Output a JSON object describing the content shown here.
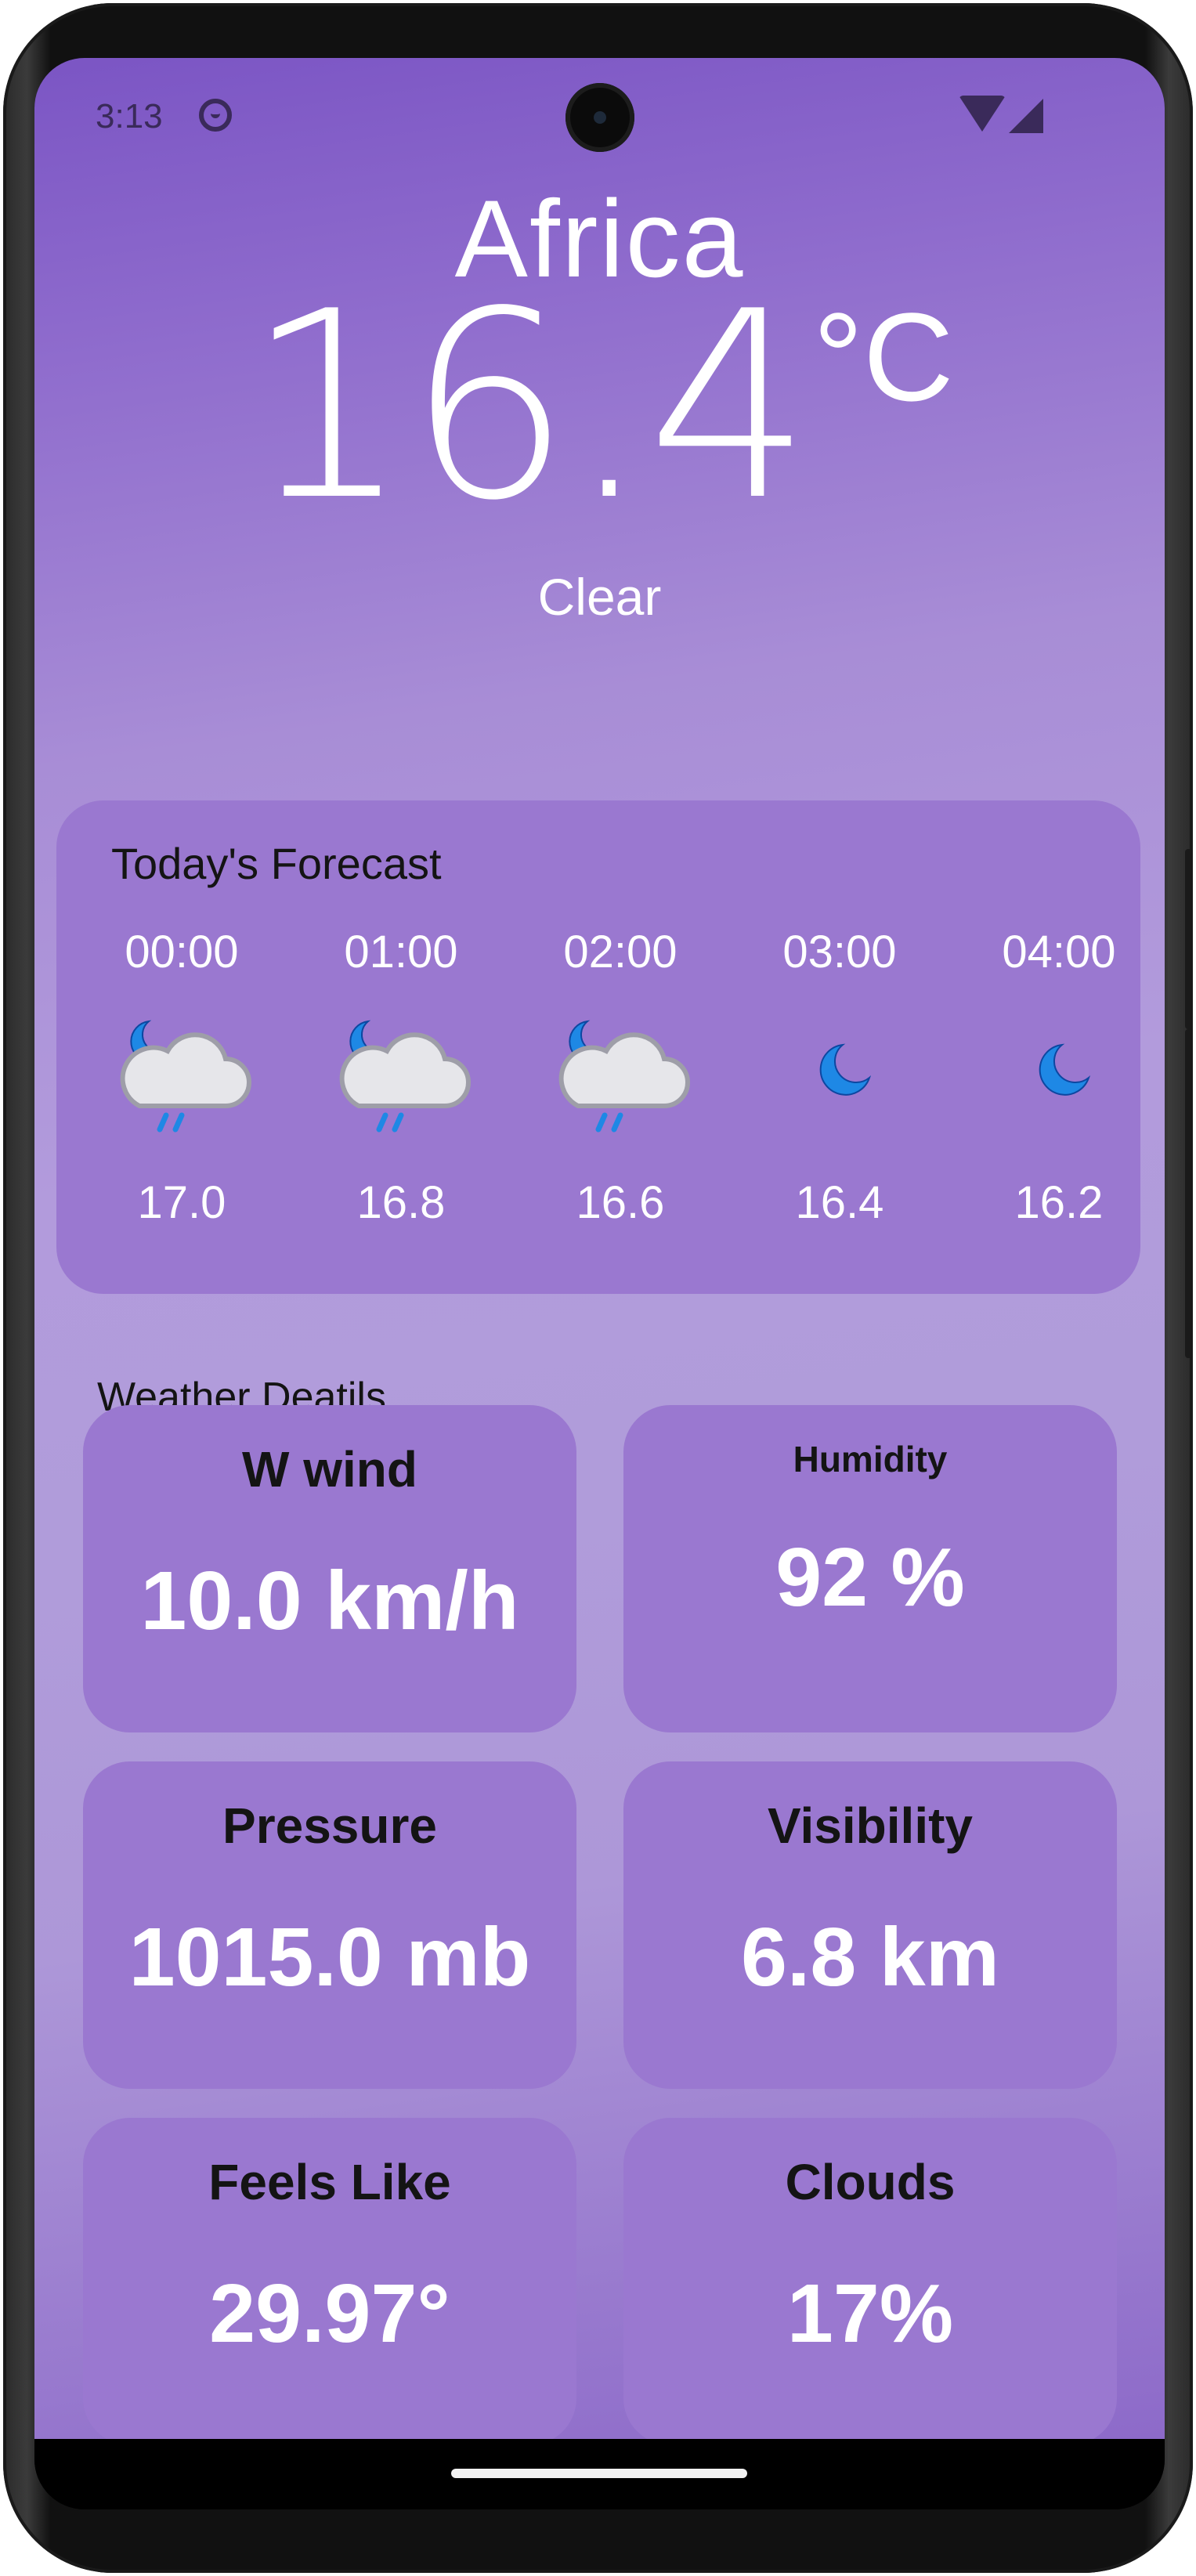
{
  "status_bar": {
    "time": "3:13"
  },
  "header": {
    "city": "Africa",
    "temperature": "16.4",
    "unit": "°C",
    "condition": "Clear"
  },
  "forecast": {
    "title": "Today's Forecast",
    "hours": [
      {
        "time": "00:00",
        "temp": "17.0",
        "icon": "moon-cloud-rain-icon"
      },
      {
        "time": "01:00",
        "temp": "16.8",
        "icon": "moon-cloud-rain-icon"
      },
      {
        "time": "02:00",
        "temp": "16.6",
        "icon": "moon-cloud-rain-icon"
      },
      {
        "time": "03:00",
        "temp": "16.4",
        "icon": "moon-icon"
      },
      {
        "time": "04:00",
        "temp": "16.2",
        "icon": "moon-icon"
      }
    ]
  },
  "details": {
    "title": "Weather Deatils",
    "wind": {
      "label": "W wind",
      "value": "10.0 km/h"
    },
    "humidity": {
      "label": "Humidity",
      "value": "92 %"
    },
    "pressure": {
      "label": "Pressure",
      "value": "1015.0 mb"
    },
    "visibility": {
      "label": "Visibility",
      "value": "6.8 km"
    },
    "feels_like": {
      "label": "Feels Like",
      "value": "29.97°"
    },
    "clouds": {
      "label": "Clouds",
      "value": "17%"
    }
  },
  "colors": {
    "background_top": "#7b55c4",
    "background_mid": "#b29bdc",
    "card": "#9a78d0",
    "text_light": "#ffffff",
    "text_dark": "#141414"
  }
}
